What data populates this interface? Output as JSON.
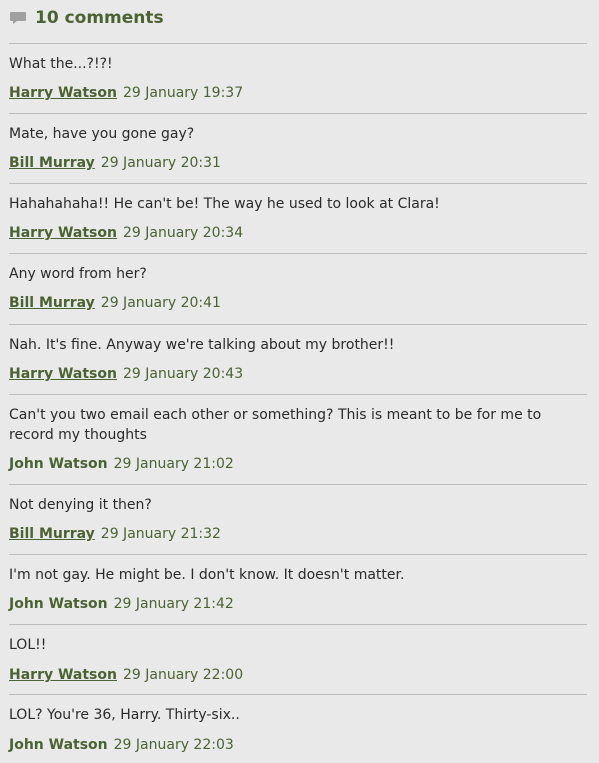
{
  "comments_header": {
    "count_label": "10 comments",
    "icon": "speech-bubble-icon",
    "accent_color": "#4b6332"
  },
  "comments": [
    {
      "text": "What the...?!?!",
      "author": "Harry Watson",
      "author_link": true,
      "date": "29 January 19:37"
    },
    {
      "text": "Mate, have you gone gay?",
      "author": "Bill Murray",
      "author_link": true,
      "date": "29 January 20:31"
    },
    {
      "text": "Hahahahaha!! He can't be! The way he used to look at Clara!",
      "author": "Harry Watson",
      "author_link": true,
      "date": "29 January 20:34"
    },
    {
      "text": "Any word from her?",
      "author": "Bill Murray",
      "author_link": true,
      "date": "29 January 20:41"
    },
    {
      "text": "Nah. It's fine. Anyway we're talking about my brother!!",
      "author": "Harry Watson",
      "author_link": true,
      "date": "29 January 20:43"
    },
    {
      "text": "Can't you two email each other or something? This is meant to be for me to record my thoughts",
      "author": "John Watson",
      "author_link": false,
      "date": "29 January 21:02"
    },
    {
      "text": "Not denying it then?",
      "author": "Bill Murray",
      "author_link": true,
      "date": "29 January 21:32"
    },
    {
      "text": "I'm not gay. He might be. I don't know. It doesn't matter.",
      "author": "John Watson",
      "author_link": false,
      "date": "29 January 21:42"
    },
    {
      "text": "LOL!!",
      "author": "Harry Watson",
      "author_link": true,
      "date": "29 January 22:00"
    },
    {
      "text": "LOL? You're 36, Harry. Thirty-six..",
      "author": "John Watson",
      "author_link": false,
      "date": "29 January 22:03"
    }
  ]
}
